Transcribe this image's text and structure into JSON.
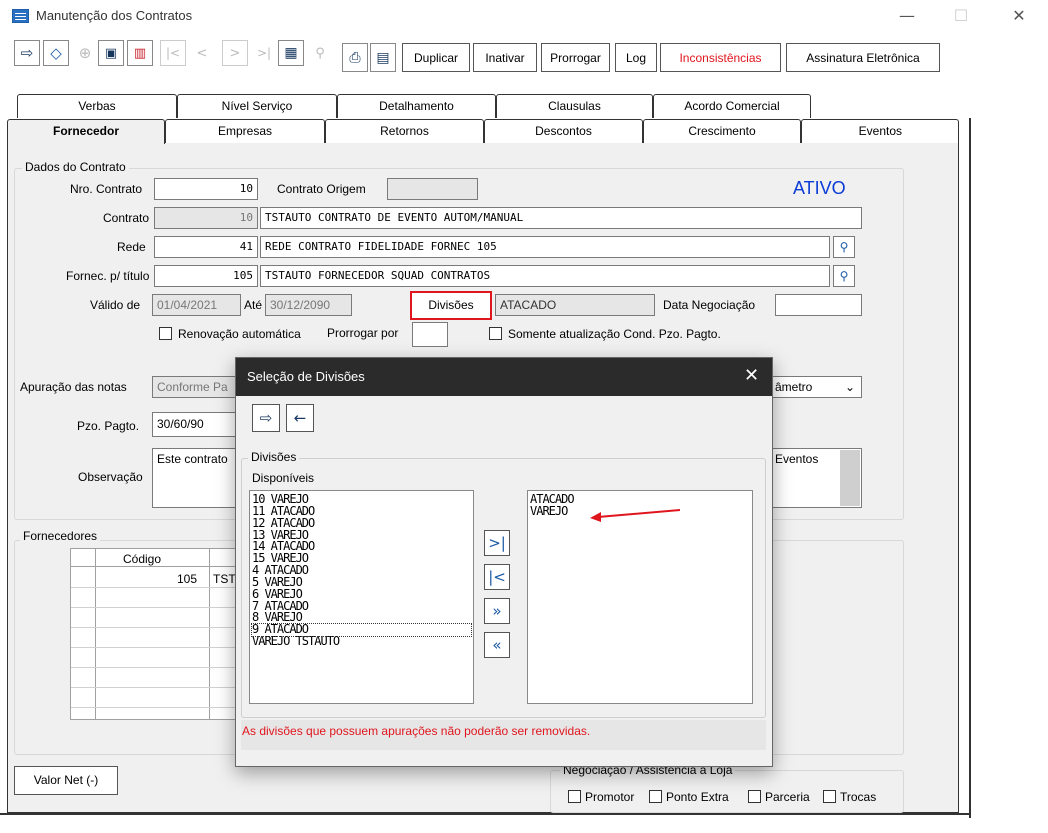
{
  "window": {
    "title": "Manutenção dos Contratos",
    "minimize": "—",
    "maximize": "☐",
    "close": "✕"
  },
  "toolbar": {
    "icons": {
      "exit": "⇨",
      "clear": "⌫",
      "add": "⊕",
      "save": "💾",
      "delete": "🗑",
      "first": "|<",
      "prev": "<",
      "next": ">",
      "last": ">|",
      "grid": "▦",
      "search": "🔍",
      "print": "⎙",
      "calc": "▤"
    },
    "buttons": [
      "Duplicar",
      "Inativar",
      "Prorrogar",
      "Log",
      "Inconsistências",
      "Assinatura Eletrônica"
    ]
  },
  "tabs_row1": [
    "Verbas",
    "Nível Serviço",
    "Detalhamento",
    "Clausulas",
    "Acordo Comercial"
  ],
  "tabs_row2": [
    "Fornecedor",
    "Empresas",
    "Retornos",
    "Descontos",
    "Crescimento",
    "Eventos"
  ],
  "dados": {
    "group_label": "Dados do Contrato",
    "nro_contrato_label": "Nro. Contrato",
    "nro_contrato": "10",
    "contrato_origem_label": "Contrato Origem",
    "contrato_origem": "",
    "status": "ATIVO",
    "contrato_label": "Contrato",
    "contrato_num": "10",
    "contrato_desc": "TSTAUTO CONTRATO DE EVENTO AUTOM/MANUAL",
    "rede_label": "Rede",
    "rede_num": "41",
    "rede_desc": "REDE CONTRATO FIDELIDADE FORNEC 105",
    "fornec_label": "Fornec. p/ título",
    "fornec_num": "105",
    "fornec_desc": "TSTAUTO FORNECEDOR SQUAD CONTRATOS",
    "valido_de_label": "Válido de",
    "valido_de": "01/04/2021",
    "ate_label": "Até",
    "ate": "30/12/2090",
    "divisoes_btn": "Divisões",
    "divisoes_value": "ATACADO",
    "data_negociacao_label": "Data Negociação",
    "data_negociacao": "",
    "renovacao_label": "Renovação automática",
    "prorrogar_por_label": "Prorrogar por",
    "prorrogar_por": "",
    "somente_label": "Somente atualização Cond. Pzo. Pagto.",
    "apuracao_label": "Apuração das notas",
    "apuracao_value": "Conforme Pa",
    "parametro_value": "âmetro",
    "pzo_pagto_label": "Pzo. Pagto.",
    "pzo_pagto": "30/60/90",
    "observacao_label": "Observação",
    "observacao": "Este contrato",
    "eventos_text": "Eventos"
  },
  "fornecedores": {
    "group_label": "Fornecedores",
    "col_codigo": "Código",
    "row1_codigo": "105",
    "row1_desc": "TST"
  },
  "valor_net_btn": "Valor Net (-)",
  "negociacao": {
    "group_label": "Negociação / Assistência a Loja",
    "promotor": "Promotor",
    "ponto_extra": "Ponto Extra",
    "parceria": "Parceria",
    "trocas": "Trocas"
  },
  "dialog": {
    "title": "Seleção de Divisões",
    "close": "✕",
    "icons": {
      "exit": "⇨",
      "back": "←"
    },
    "group_label": "Divisões",
    "disponiveis_label": "Disponíveis",
    "available": [
      "10 VAREJO",
      "11 ATACADO",
      "12 ATACADO",
      "13 VAREJO",
      "14 ATACADO",
      "15 VAREJO",
      "4 ATACADO",
      "5 VAREJO",
      "6 VAREJO",
      "7 ATACADO",
      "8 VAREJO",
      "9 ATACADO",
      "VAREJO TSTAUTO"
    ],
    "selected": [
      "ATACADO",
      "VAREJO"
    ],
    "move_buttons": {
      "add": ">|",
      "remove": "|<",
      "add_all": "»",
      "remove_all": "«"
    },
    "message": "As divisões que possuem apurações não poderão ser removidas."
  },
  "colors": {
    "accent_blue": "#1c5aa6",
    "status_blue": "#0a3bd6",
    "warning_red": "#e0161e",
    "dialog_title_bg": "#2b2b2b",
    "highlight_red": "#e0161e"
  }
}
